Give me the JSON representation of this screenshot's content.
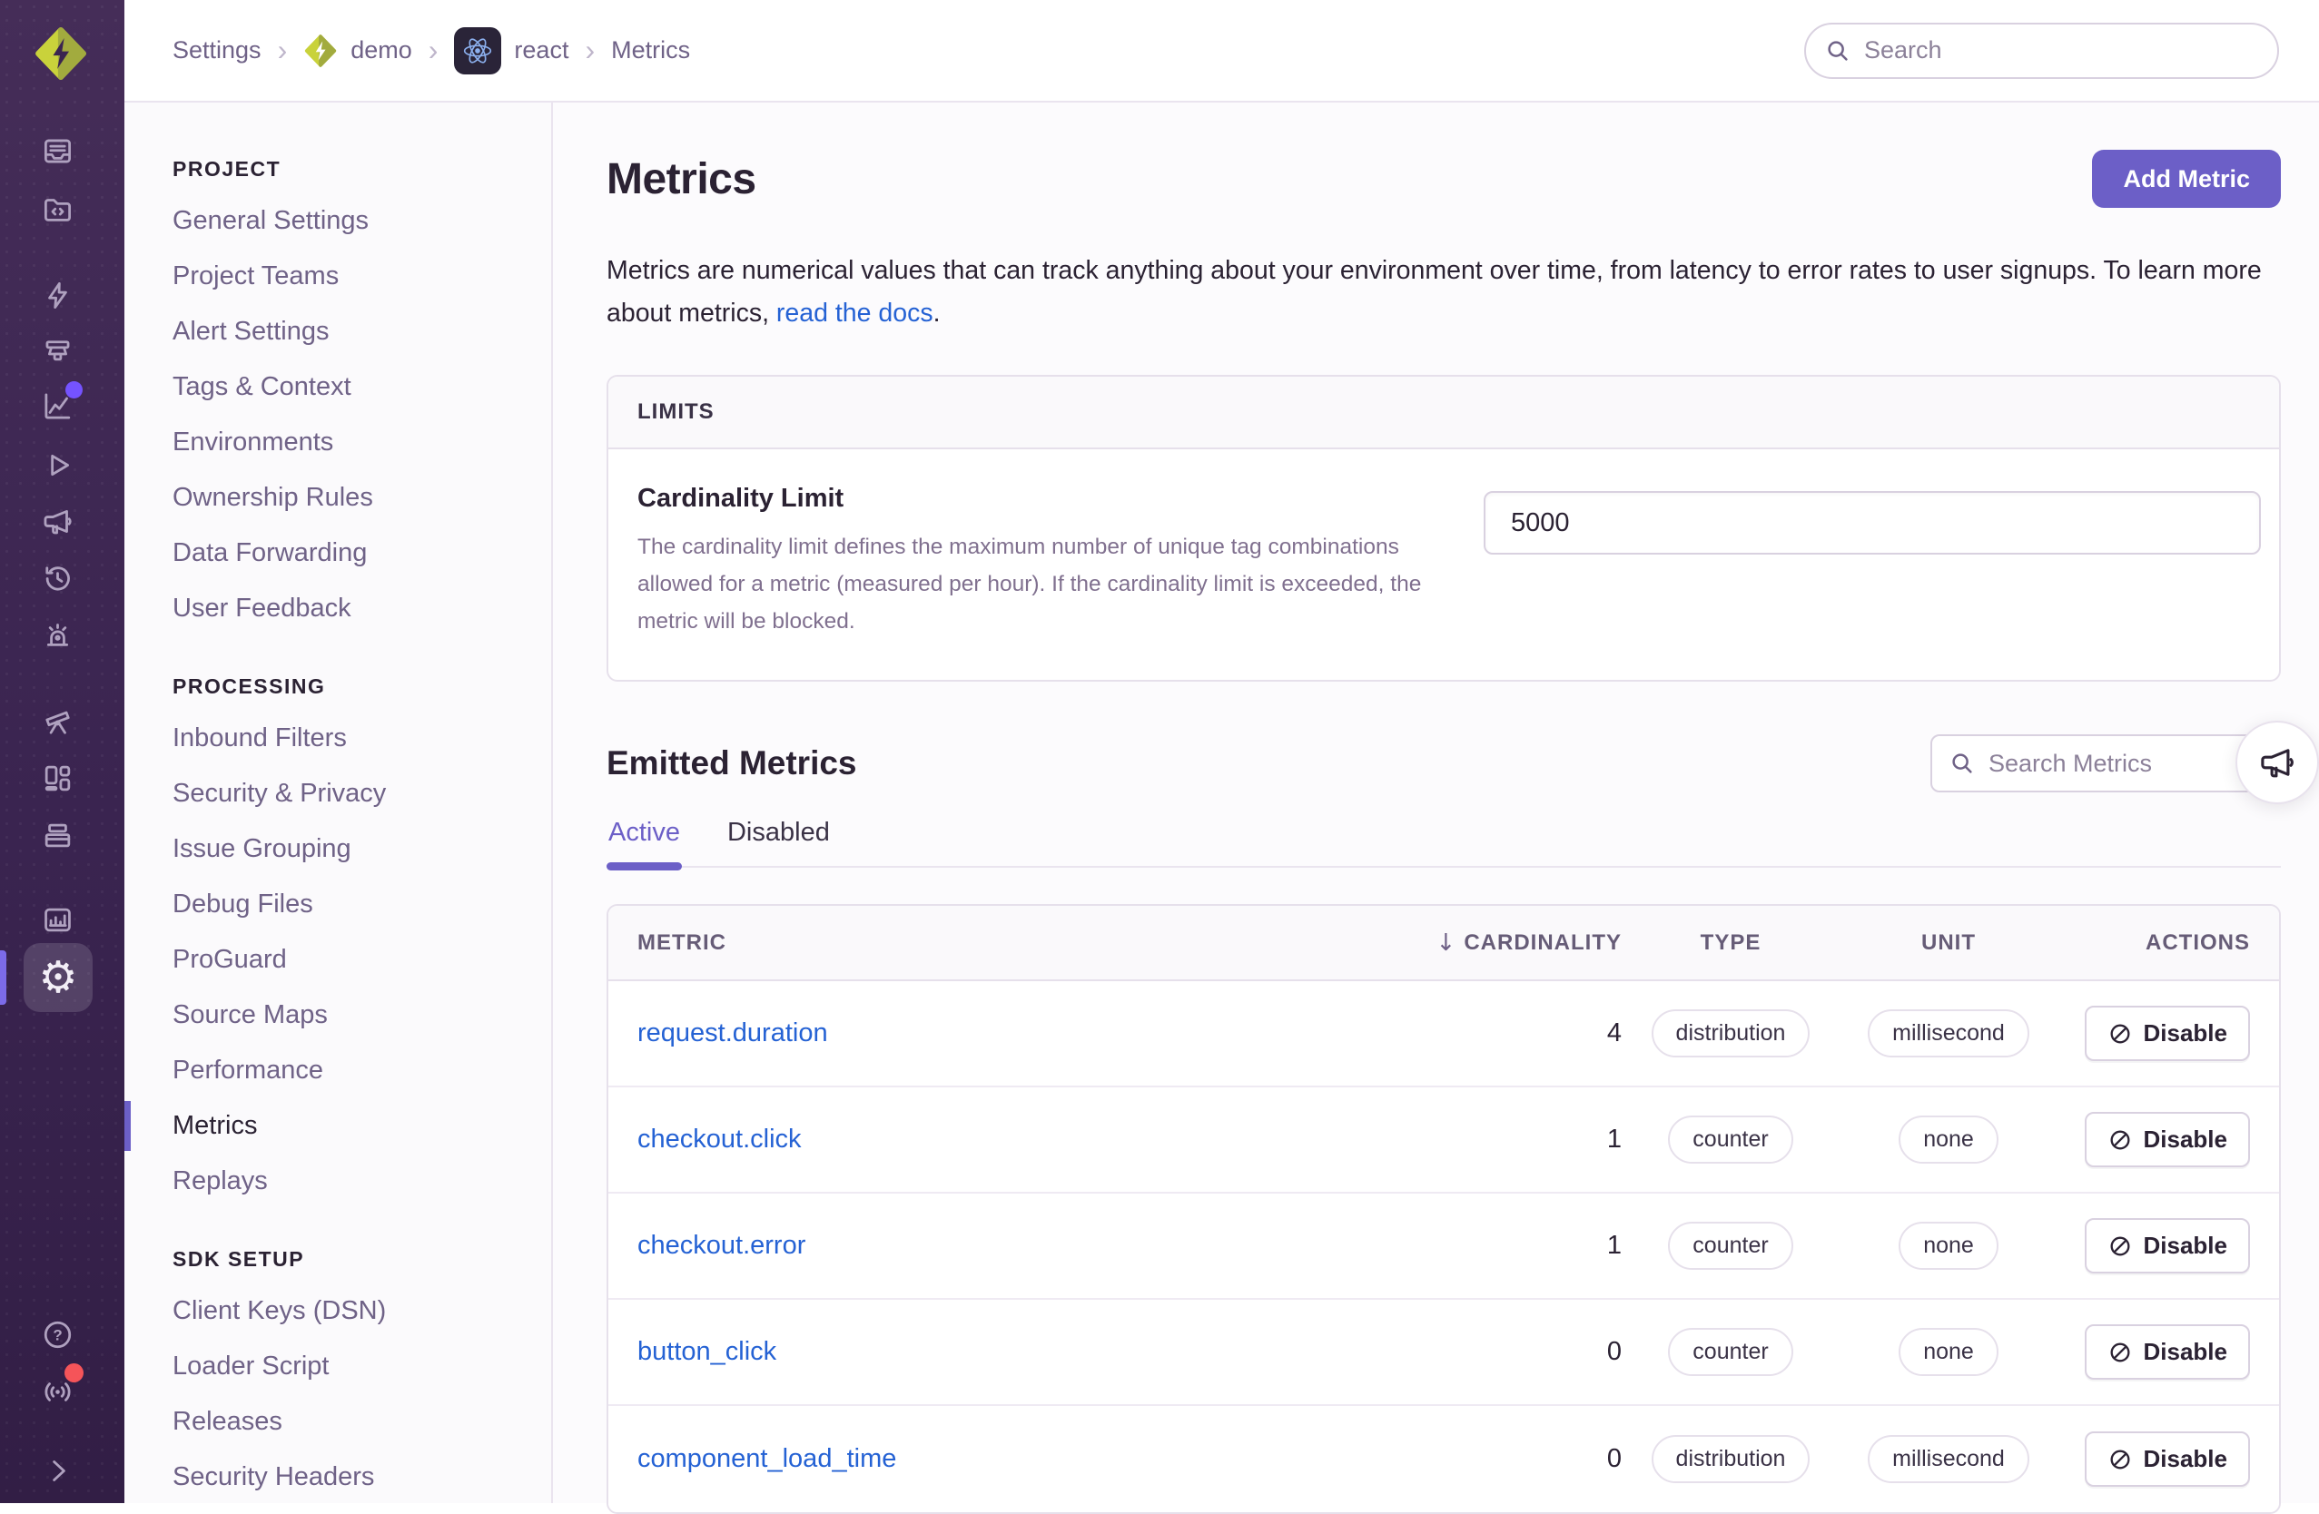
{
  "colors": {
    "accent": "#6C5FC7",
    "link": "#2562D4",
    "rail_background": "#3A2450",
    "notification_purple": "#7553FF",
    "notification_red": "#F55459",
    "logo_green_light": "#C9D23B",
    "logo_green_dark": "#A2AB3E"
  },
  "icons": {
    "breadcrumb_separator": "›",
    "sort_desc": "↓",
    "gear": "⚙",
    "help": "?"
  },
  "rail": {
    "items": [
      "sentry-logo",
      "issues",
      "projects",
      "performance",
      "profiling",
      "metrics",
      "replays",
      "feedback",
      "crons",
      "alerts",
      "discover",
      "dashboards",
      "releases",
      "stats",
      "settings",
      "help",
      "service-updates",
      "collapse"
    ],
    "active": "settings"
  },
  "topbar": {
    "search_placeholder": "Search"
  },
  "breadcrumb": {
    "items": [
      {
        "label": "Settings"
      },
      {
        "label": "demo",
        "icon": "org-avatar"
      },
      {
        "label": "react",
        "icon": "react-project"
      },
      {
        "label": "Metrics"
      }
    ]
  },
  "settings_nav": {
    "sections": [
      {
        "title": "PROJECT",
        "items": [
          "General Settings",
          "Project Teams",
          "Alert Settings",
          "Tags & Context",
          "Environments",
          "Ownership Rules",
          "Data Forwarding",
          "User Feedback"
        ]
      },
      {
        "title": "PROCESSING",
        "items": [
          "Inbound Filters",
          "Security & Privacy",
          "Issue Grouping",
          "Debug Files",
          "ProGuard",
          "Source Maps",
          "Performance",
          "Metrics",
          "Replays"
        ],
        "active_item": "Metrics"
      },
      {
        "title": "SDK SETUP",
        "items": [
          "Client Keys (DSN)",
          "Loader Script",
          "Releases",
          "Security Headers"
        ]
      }
    ]
  },
  "page": {
    "title": "Metrics",
    "add_button": "Add Metric",
    "description_before": "Metrics are numerical values that can track anything about your environment over time, from latency to error rates to user signups. To learn more about metrics, ",
    "description_link": "read the docs",
    "description_after": ".",
    "limits": {
      "panel_title": "LIMITS",
      "field_label": "Cardinality Limit",
      "field_help": "The cardinality limit defines the maximum number of unique tag combinations allowed for a metric (measured per hour). If the cardinality limit is exceeded, the metric will be blocked.",
      "value": "5000"
    },
    "emitted": {
      "title": "Emitted Metrics",
      "search_placeholder": "Search Metrics",
      "tabs": [
        "Active",
        "Disabled"
      ],
      "active_tab": "Active",
      "table": {
        "headers": [
          "METRIC",
          "CARDINALITY",
          "TYPE",
          "UNIT",
          "ACTIONS"
        ],
        "sorted_by": "CARDINALITY",
        "rows": [
          {
            "metric": "request.duration",
            "cardinality": "4",
            "type": "distribution",
            "unit": "millisecond",
            "action": "Disable"
          },
          {
            "metric": "checkout.click",
            "cardinality": "1",
            "type": "counter",
            "unit": "none",
            "action": "Disable"
          },
          {
            "metric": "checkout.error",
            "cardinality": "1",
            "type": "counter",
            "unit": "none",
            "action": "Disable"
          },
          {
            "metric": "button_click",
            "cardinality": "0",
            "type": "counter",
            "unit": "none",
            "action": "Disable"
          },
          {
            "metric": "component_load_time",
            "cardinality": "0",
            "type": "distribution",
            "unit": "millisecond",
            "action": "Disable"
          }
        ]
      }
    }
  }
}
